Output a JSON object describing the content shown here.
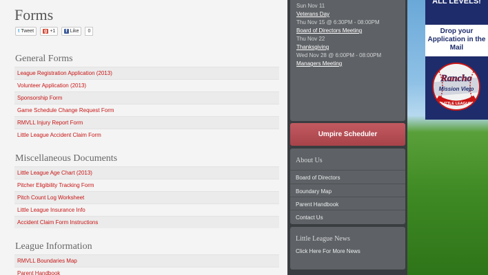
{
  "main": {
    "title": "Forms",
    "social": {
      "tweet": "Tweet",
      "gplus": "+1",
      "like": "Like",
      "like_count": "0"
    },
    "sections": [
      {
        "title": "General Forms",
        "items": [
          "League Registration Application (2013)",
          "Volunteer Application (2013)",
          "Sponsorship Form",
          "Game Schedule Change Request Form",
          "RMVLL Injury Report Form",
          "Little League Accident Claim Form"
        ]
      },
      {
        "title": "Miscellaneous Documents",
        "items": [
          "Little League Age Chart (2013)",
          "Pitcher Eligibility Tracking Form",
          "Pitch Count Log Worksheet",
          "Little League Insurance Info",
          "Accident Claim Form Instructions"
        ]
      },
      {
        "title": "League Information",
        "items": [
          "RMVLL Boundaries Map",
          "Parent Handbook"
        ]
      }
    ]
  },
  "events": [
    {
      "date": "Sun Nov 11",
      "name": "Veterans Day"
    },
    {
      "date": "Thu Nov 15 @ 6:30PM - 08:00PM",
      "name": "Board of Directors Meeting"
    },
    {
      "date": "Thu Nov 22",
      "name": "Thanksgiving"
    },
    {
      "date": "Wed Nov 28 @ 6:00PM - 08:00PM",
      "name": "Managers Meeting"
    }
  ],
  "sidebar": {
    "umpire_button": "Umpire Scheduler",
    "about": {
      "title": "About Us",
      "links": [
        "Board of Directors",
        "Boundary Map",
        "Parent Handbook",
        "Contact Us"
      ]
    },
    "news": {
      "title": "Little League News",
      "link": "Click Here For More News"
    }
  },
  "ad": {
    "top_text": "ALL LEVELS!",
    "mid_text": "Drop your Application in the Mail",
    "logo_text_top": "Rancho",
    "logo_text_mid": "Mission Viejo",
    "logo_text_bottom": "LITTLE LEAGUE",
    "colors": {
      "navy": "#1e2c6b",
      "red": "#c81414"
    }
  }
}
